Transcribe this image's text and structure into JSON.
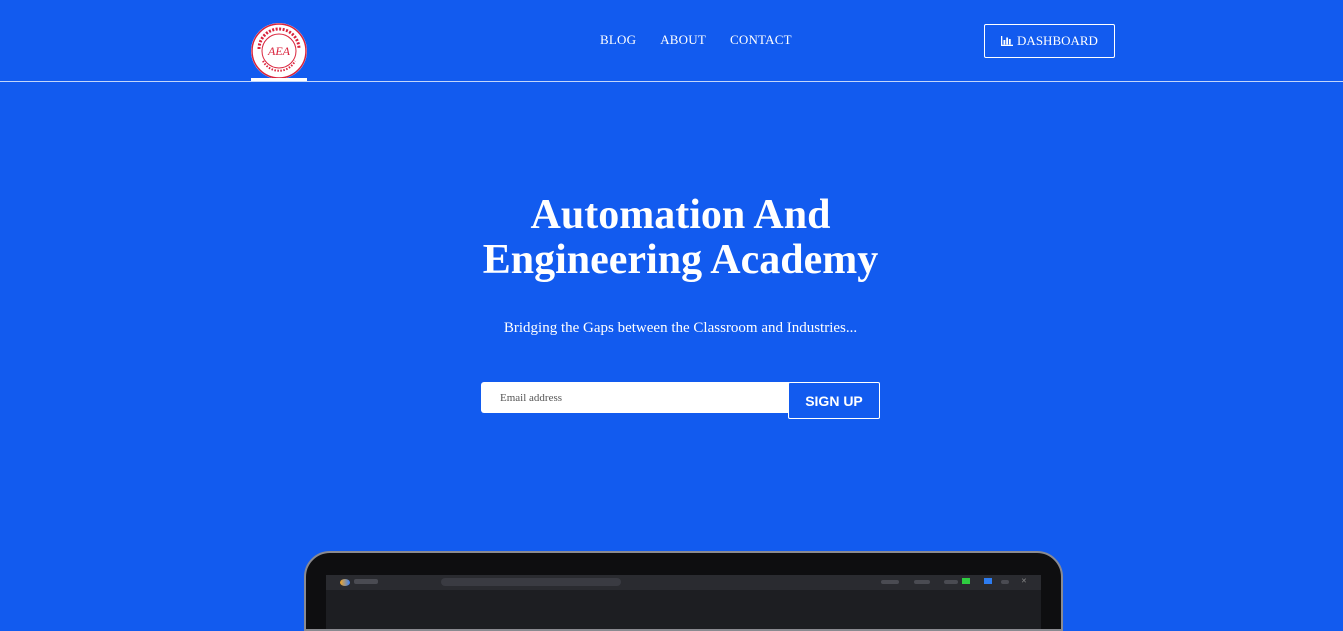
{
  "header": {
    "logo_text": "AUTOMATION AND ENGINEERING ACADEMY",
    "logo_initials": "AEA",
    "nav": [
      {
        "label": "BLOG"
      },
      {
        "label": "ABOUT"
      },
      {
        "label": "CONTACT"
      }
    ],
    "dashboard_label": "DASHBOARD",
    "dashboard_icon": "bar-chart-icon"
  },
  "hero": {
    "title_line1": "Automation And",
    "title_line2": "Engineering Academy",
    "subtitle": "Bridging the Gaps between the Classroom and Industries...",
    "email_placeholder": "Email address",
    "signup_label": "SIGN UP"
  },
  "colors": {
    "background": "#125bef",
    "text": "#ffffff",
    "logo_accent": "#d9223b"
  }
}
